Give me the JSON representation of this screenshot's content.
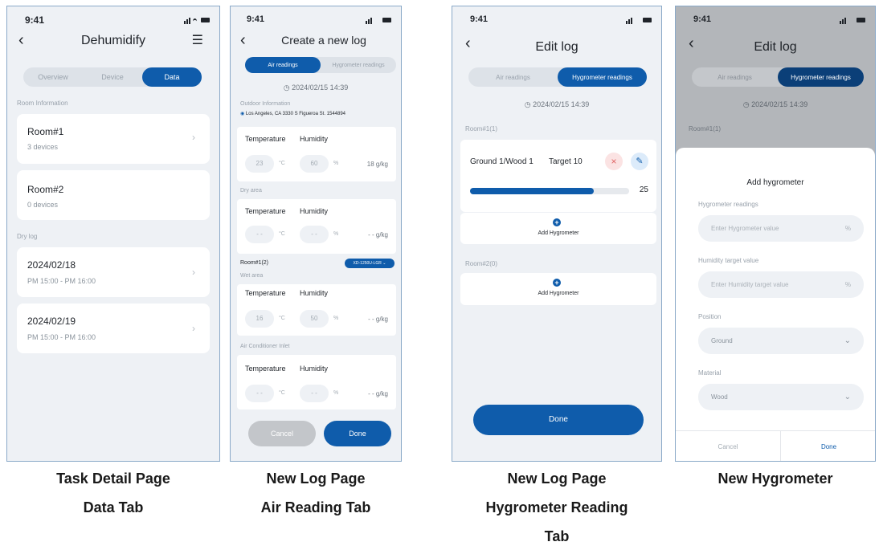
{
  "status_time": "9:41",
  "screen1": {
    "title": "Dehumidify",
    "tabs": [
      "Overview",
      "Device",
      "Data"
    ],
    "room_section": "Room Information",
    "rooms": [
      {
        "name": "Room#1",
        "devices": "3 devices"
      },
      {
        "name": "Room#2",
        "devices": "0 devices"
      }
    ],
    "dry_section": "Dry log",
    "logs": [
      {
        "date": "2024/02/18",
        "time": "PM 15:00 - PM 16:00"
      },
      {
        "date": "2024/02/19",
        "time": "PM 15:00 - PM 16:00"
      }
    ],
    "caption_line1": "Task Detail Page",
    "caption_line2": "Data Tab"
  },
  "screen2": {
    "title": "Create a new log",
    "tabs": [
      "Air readings",
      "Hygrometer readings"
    ],
    "datetime": "2024/02/15 14:39",
    "outdoor_label": "Outdoor Information",
    "address": "Los Angeles, CA  3330 S Figueroa St.  1544894",
    "temperature_label": "Temperature",
    "humidity_label": "Humidity",
    "outdoor": {
      "temp": "23",
      "temp_unit": "°C",
      "hum": "60",
      "hum_unit": "%",
      "gkg": "18 g/kg"
    },
    "dry_area_label": "Dry area",
    "dry": {
      "temp": "- -",
      "temp_unit": "°C",
      "hum": "- -",
      "hum_unit": "%",
      "gkg": "- - g/kg"
    },
    "room_label": "Room#1(2)",
    "device_chip": "XD-1250U-LGR",
    "wet_area_label": "Wet area",
    "wet": {
      "temp": "16",
      "temp_unit": "°C",
      "hum": "50",
      "hum_unit": "%",
      "gkg": "- - g/kg"
    },
    "ac_label": "Air Conditioner Inlet",
    "ac": {
      "temp": "- -",
      "temp_unit": "°C",
      "hum": "- -",
      "hum_unit": "%",
      "gkg": "- - g/kg"
    },
    "cancel": "Cancel",
    "done": "Done",
    "caption_line1": "New Log Page",
    "caption_line2": "Air Reading Tab"
  },
  "screen3": {
    "title": "Edit log",
    "tabs": [
      "Air readings",
      "Hygrometer readings"
    ],
    "datetime": "2024/02/15 14:39",
    "room1_label": "Room#1(1)",
    "hygrometer_name": "Ground 1/Wood 1",
    "target": "Target 10",
    "progress_value": "25",
    "progress_fraction": 0.78,
    "add_hygrometer": "Add Hygrometer",
    "room2_label": "Room#2(0)",
    "done": "Done",
    "caption_line1": "New Log Page",
    "caption_line2": "Hygrometer Reading",
    "caption_line3": "Tab"
  },
  "screen4": {
    "title": "Edit log",
    "tabs": [
      "Air readings",
      "Hygrometer readings"
    ],
    "datetime": "2024/02/15 14:39",
    "room1_label": "Room#1(1)",
    "sheet_title": "Add hygrometer",
    "readings_label": "Hygrometer readings",
    "readings_placeholder": "Enter Hygrometer value",
    "readings_unit": "%",
    "target_label": "Humidity target value",
    "target_placeholder": "Enter Humidity target value",
    "target_unit": "%",
    "position_label": "Position",
    "position_value": "Ground",
    "material_label": "Material",
    "material_value": "Wood",
    "cancel": "Cancel",
    "done": "Done",
    "caption": "New Hygrometer"
  },
  "colors": {
    "accent": "#0f5cab",
    "background": "#eef1f5",
    "danger": "#e06565"
  }
}
